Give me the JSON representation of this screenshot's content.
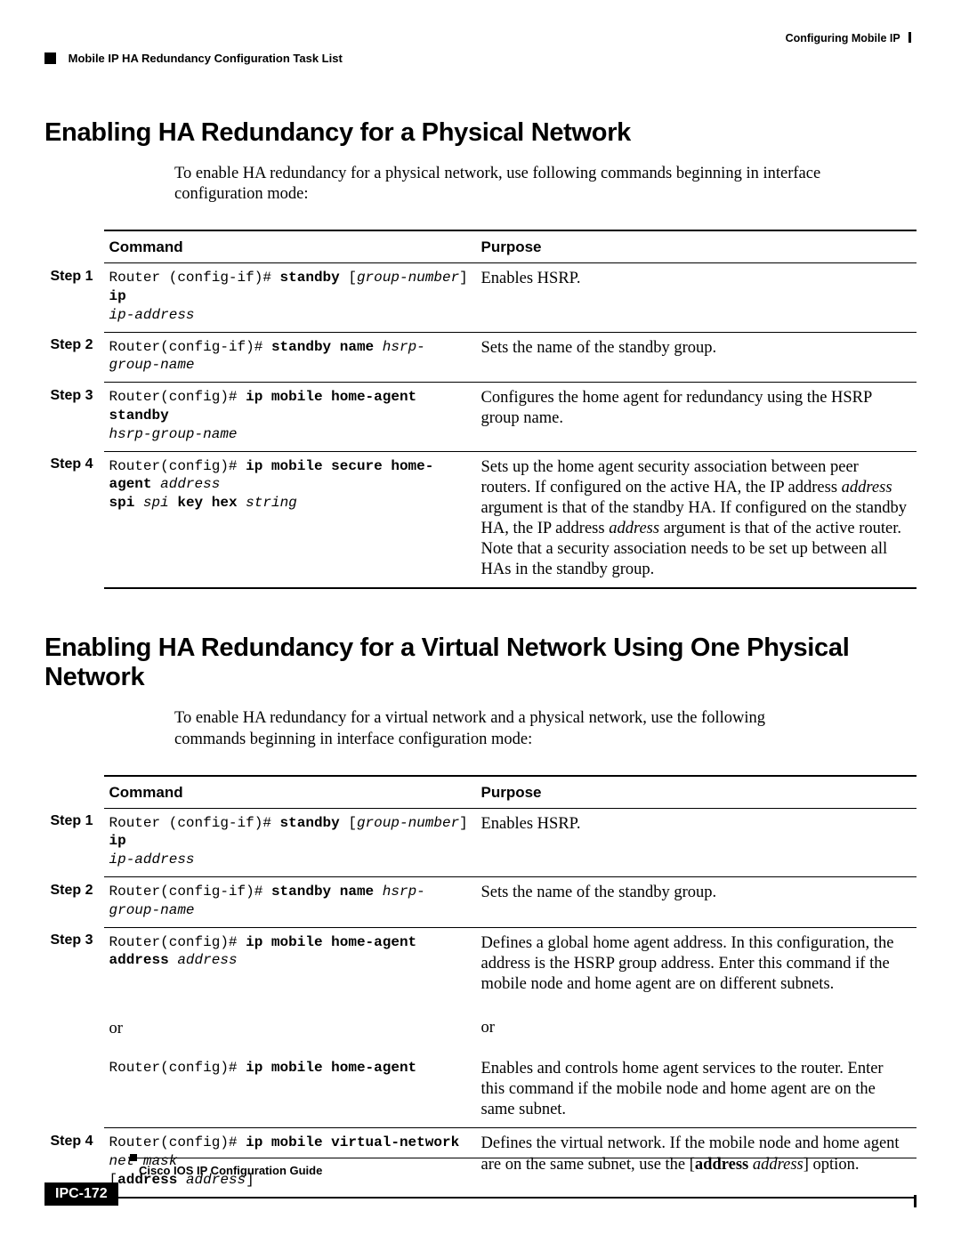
{
  "header": {
    "chapter": "Configuring Mobile IP",
    "section": "Mobile IP HA Redundancy Configuration Task List"
  },
  "s1": {
    "title": "Enabling HA Redundancy for a Physical Network",
    "intro": "To enable HA redundancy for a physical network, use following commands beginning in interface configuration mode:",
    "th_command": "Command",
    "th_purpose": "Purpose",
    "steps": {
      "1": {
        "label": "Step 1",
        "purpose": "Enables HSRP."
      },
      "2": {
        "label": "Step 2",
        "purpose": "Sets the name of the standby group."
      },
      "3": {
        "label": "Step 3",
        "purpose": "Configures the home agent for redundancy using the HSRP group name."
      },
      "4": {
        "label": "Step 4"
      }
    }
  },
  "s2": {
    "title": "Enabling HA Redundancy for a Virtual Network Using One Physical Network",
    "intro": "To enable HA redundancy for a virtual network and a physical network, use the following commands beginning in interface configuration mode:",
    "th_command": "Command",
    "th_purpose": "Purpose",
    "steps": {
      "1": {
        "label": "Step 1",
        "purpose": "Enables HSRP."
      },
      "2": {
        "label": "Step 2",
        "purpose": "Sets the name of the standby group."
      },
      "3": {
        "label": "Step 3",
        "purpose_a": "Defines a global home agent address. In this configuration, the address is the HSRP group address. Enter this command if the mobile node and home agent are on different subnets.",
        "or": "or",
        "purpose_b": "Enables and controls home agent services to the router. Enter this command if the mobile node and home agent are on the same subnet."
      },
      "4": {
        "label": "Step 4"
      }
    }
  },
  "cmd": {
    "standby_ip_pre": "Router (config-if)# ",
    "standby_ip_kw1": "standby",
    "standby_ip_arg1": "group-number",
    "standby_ip_kw2": "ip",
    "standby_ip_arg2": "ip-address",
    "standby_name_pre": "Router(config-if)# ",
    "standby_name_kw": "standby name",
    "standby_name_arg": "hsrp-group-name",
    "ha_standby_pre": "Router(config)# ",
    "ha_standby_kw": "ip mobile home-agent standby",
    "ha_standby_arg": "hsrp-group-name",
    "secure_pre": "Router(config)# ",
    "secure_kw1": "ip mobile secure home-agent",
    "secure_arg1": "address",
    "secure_kw2": "spi",
    "secure_arg2": "spi",
    "secure_kw3": "key hex",
    "secure_arg3": "string",
    "ha_addr_pre": "Router(config)# ",
    "ha_addr_kw": "ip mobile home-agent address",
    "ha_addr_arg": "address",
    "ha_plain_pre": "Router(config)# ",
    "ha_plain_kw": "ip mobile home-agent",
    "vnet_pre": "Router(config)# ",
    "vnet_kw": "ip mobile virtual-network",
    "vnet_arg1": "net mask",
    "vnet_kw2": "address",
    "vnet_arg2": "address"
  },
  "purpose4": {
    "p1": "Sets up the home agent security association between peer routers. If configured on the active HA, the IP address ",
    "i1": "address",
    "p2": " argument is that of the standby HA. If configured on the standby HA, the IP address ",
    "i2": "address",
    "p3": " argument is that of the active router. Note that a security association needs to be set up between all HAs in the standby group."
  },
  "purpose_s2_4": {
    "p1": "Defines the virtual network. If the mobile node and home agent are on the same subnet, use the [",
    "b1": "address ",
    "i1": "address",
    "p2": "] option."
  },
  "footer": {
    "guide": "Cisco IOS IP Configuration Guide",
    "page": "IPC-172"
  }
}
